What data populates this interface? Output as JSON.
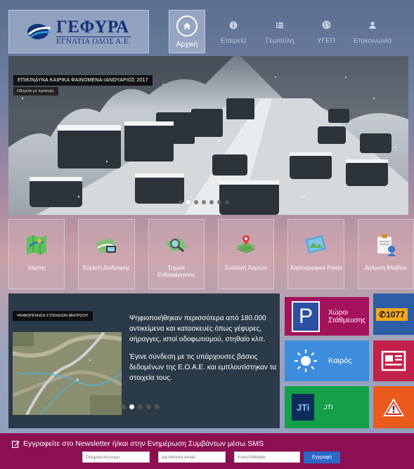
{
  "logo": {
    "title": "ΓΕΦΥΡΑ",
    "subtitle": "ΕΓΝΑΤΙΑ ΟΔΟΣ Α.Ε."
  },
  "nav": [
    {
      "label": "Αρχική",
      "icon": "home-icon",
      "active": true
    },
    {
      "label": "Εταιρεία",
      "icon": "info-icon",
      "active": false
    },
    {
      "label": "Γεωπύλη",
      "icon": "list-icon",
      "active": false
    },
    {
      "label": "ΥΓΕΠ",
      "icon": "globe-icon",
      "active": false
    },
    {
      "label": "Επικοινωνία",
      "icon": "user-icon",
      "active": false
    }
  ],
  "hero": {
    "caption": "ΕΠΙΚΙΝΔΥΝΑ ΚΑΙΡΙΚΑ ΦΑΙΝΟΜΕΝΑ-ΙΑΝΟΥΑΡΙΟΣ 2017",
    "subcaption": "Οδηγείτε με προσοχή.",
    "active_slide": 1,
    "slide_count": 7
  },
  "tiles": [
    {
      "label": "Χάρτης",
      "icon": "map-icon"
    },
    {
      "label": "Εύρεση Διαδρομής",
      "icon": "route-icon"
    },
    {
      "label": "Σημεία Ενδιαφέροντος",
      "icon": "poi-icon"
    },
    {
      "label": "Συλλογή Χαρτών",
      "icon": "maps-collection-icon"
    },
    {
      "label": "Χαρτογραφικό Portal",
      "icon": "portal-icon"
    },
    {
      "label": "Δήλωση Βλαβών",
      "icon": "report-damage-icon"
    }
  ],
  "news": {
    "caption": "ΨΗΦΙΟΠΟΙΗΣΗ ΣΤΟΙΧΕΙΩΝ ΜΗΤΡΩΟΥ",
    "paragraph1": "Ψηφιοποιήθηκαν περισσότερα από 180.000 αντικείμενα και κατασκευές όπως γέφυρες, σήραγγες, ιστοί οδοφωτισμού, στηθαίο κλπ.",
    "paragraph2": "Έγινε σύνδεση με τις υπάρχουσες βάσεις δεδομένων της Ε.Ο.Α.Ε. και εμπλουτίστηκαν τα στοιχεία τους.",
    "active_slide": 1,
    "slide_count": 5
  },
  "side": {
    "parking": {
      "letter": "P",
      "line1": "Χώροι",
      "line2": "Στάθμευσης"
    },
    "hotline": "1077",
    "weather": "Καιρός",
    "jti_logo": "JTi",
    "jti": "JTI"
  },
  "newsletter": {
    "title": "Εγγραφείτε στο Newsletter ή/και στην Ενημέρωση Συμβάντων μέσω SMS",
    "name_placeholder": "Ονοματεπώνυμο",
    "email_placeholder": "Διεύθυνση email",
    "mobile_placeholder": "Κινητό/Mobile",
    "submit": "Εγγραφή"
  },
  "colors": {
    "parking": "#a3125a",
    "weather": "#3d8ddc",
    "jti": "#13a048",
    "warning": "#ea5a1c",
    "newsletter": "#8c0f52",
    "news_panel": "#2b3a48"
  }
}
